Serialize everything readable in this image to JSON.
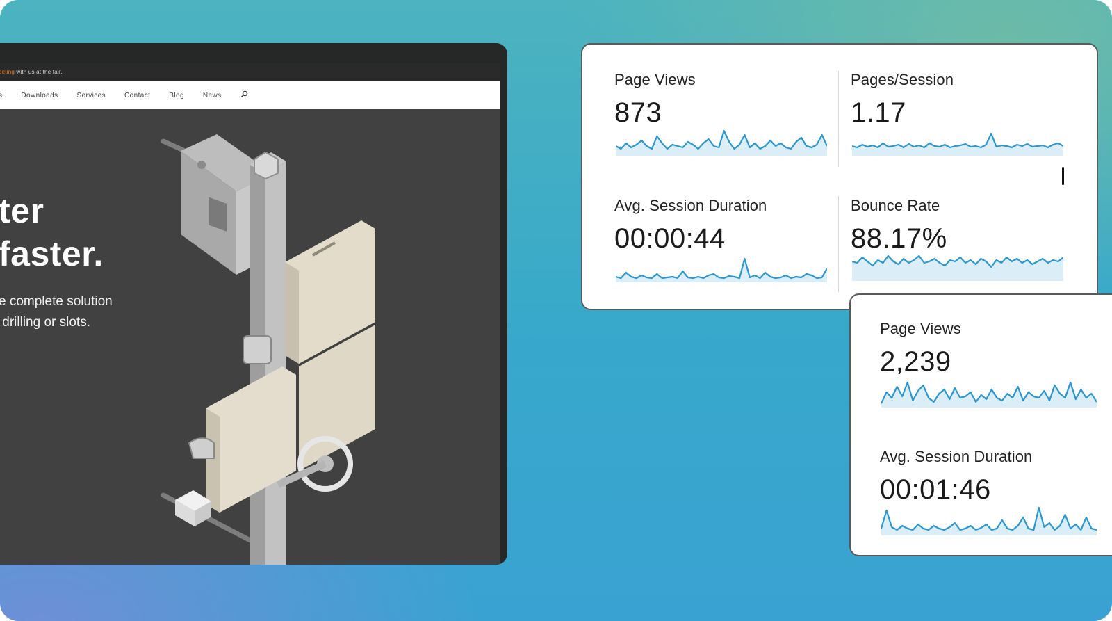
{
  "colors": {
    "accent_orange": "#f07a20",
    "spark_line": "#2a97d0",
    "spark_fill": "#dbeef8",
    "card_border": "#5a5a5a"
  },
  "website": {
    "topbar": {
      "highlight": "eeting",
      "text": " with us at the fair."
    },
    "nav": {
      "items": [
        "s",
        "Downloads",
        "Services",
        "Contact",
        "Blog",
        "News"
      ],
      "search_icon": "search-icon"
    },
    "hero": {
      "headline": "ter\nfaster.",
      "body": "e complete solution\n drilling or slots."
    }
  },
  "analytics_main": {
    "metrics": [
      {
        "label": "Page Views",
        "value": "873"
      },
      {
        "label": "Pages/Session",
        "value": "1.17"
      },
      {
        "label": "Avg. Session Duration",
        "value": "00:00:44"
      },
      {
        "label": "Bounce Rate",
        "value": "88.17%"
      }
    ]
  },
  "analytics_second": {
    "metrics": [
      {
        "label": "Page Views",
        "value": "2,239"
      },
      {
        "label": "Avg. Session Duration",
        "value": "00:01:46"
      }
    ]
  }
}
